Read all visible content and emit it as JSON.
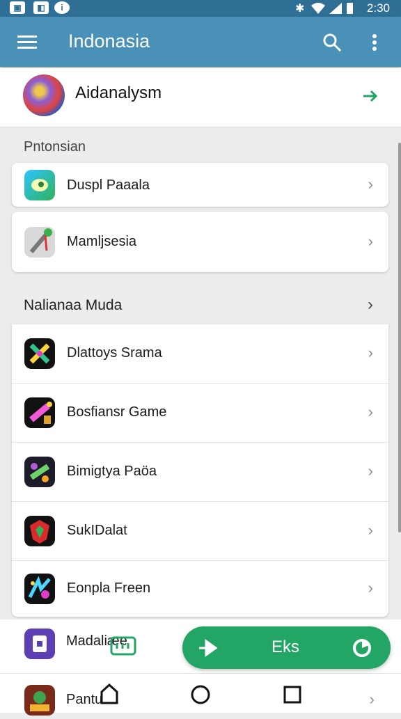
{
  "status_bar": {
    "time": "2:30"
  },
  "app_bar": {
    "title": "Indonasia"
  },
  "header": {
    "name": "Aidanalysm"
  },
  "section1": {
    "label": "Pntonsian",
    "items": [
      {
        "label": "Duspl Paaala"
      },
      {
        "label": "Mamljsesia"
      }
    ]
  },
  "section2": {
    "label": "Nalianaa Muda",
    "items": [
      {
        "label": "Dlattoys Srama"
      },
      {
        "label": "Bosfiansr Game"
      },
      {
        "label": "Bimigtya Paöa"
      },
      {
        "label": "SukIDalat"
      },
      {
        "label": "Eonpla Freen"
      }
    ]
  },
  "bottom_list": {
    "items": [
      {
        "label": "Madaliæe"
      },
      {
        "label": "Pantu"
      }
    ]
  },
  "fab": {
    "label": "Eks"
  }
}
